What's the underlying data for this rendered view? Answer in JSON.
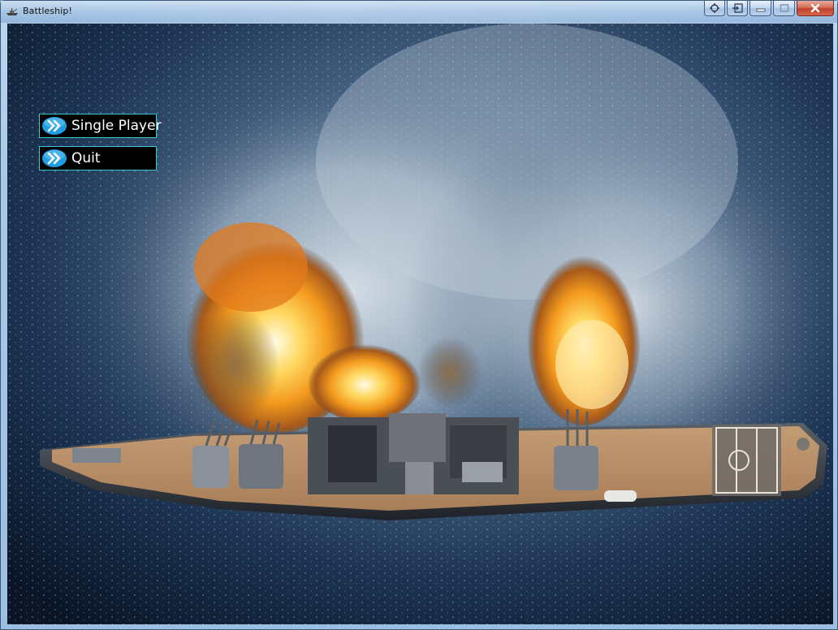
{
  "window": {
    "title": "Battleship!",
    "app_icon": "battleship-app-icon",
    "caption_buttons": [
      "window-options-icon",
      "tray-icon",
      "minimize-icon",
      "maximize-icon",
      "close-icon"
    ]
  },
  "menu": {
    "items": [
      {
        "label": "Single Player",
        "icon": "double-chevron-right-icon"
      },
      {
        "label": "Quit",
        "icon": "double-chevron-right-icon"
      }
    ]
  },
  "background": {
    "subject": "battleship-firing-broadside-image"
  },
  "colors": {
    "menu_border": "#3fc7cf",
    "menu_bg": "#000000",
    "menu_text": "#ffffff",
    "chevron_blue": "#1f9be0"
  }
}
